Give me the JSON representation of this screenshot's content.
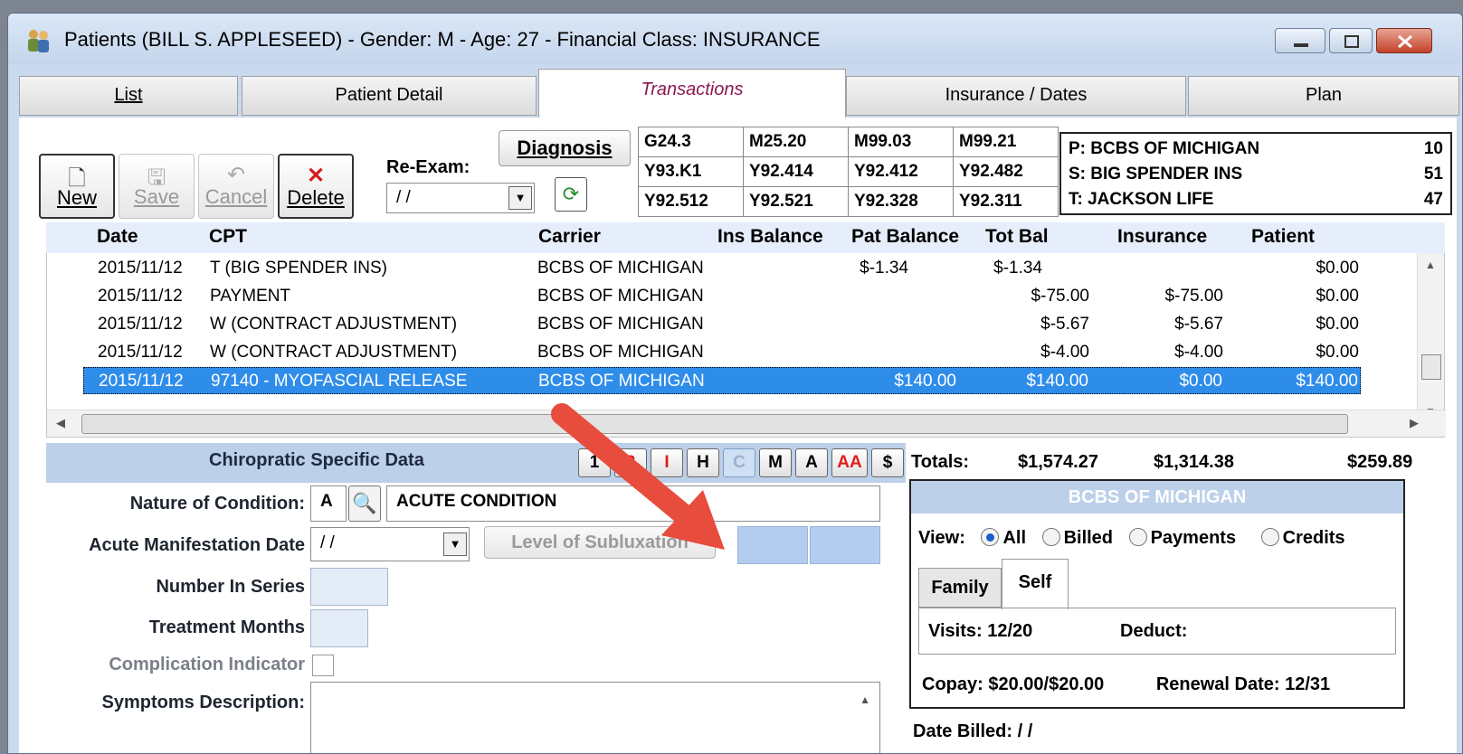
{
  "window": {
    "title": "Patients (BILL S. APPLESEED) - Gender: M - Age: 27 - Financial Class: INSURANCE"
  },
  "tabs": [
    {
      "label": "List"
    },
    {
      "label": "Patient Detail"
    },
    {
      "label": "Transactions"
    },
    {
      "label": "Insurance / Dates"
    },
    {
      "label": "Plan"
    }
  ],
  "toolbar": {
    "new_label": "New",
    "save_label": "Save",
    "cancel_label": "Cancel",
    "delete_label": "Delete",
    "reexam_label": "Re-Exam:",
    "reexam_value": "/ /",
    "diagnosis_label": "Diagnosis"
  },
  "diagnosis_codes": [
    [
      "G24.3",
      "M25.20",
      "M99.03",
      "M99.21"
    ],
    [
      "Y93.K1",
      "Y92.414",
      "Y92.412",
      "Y92.482"
    ],
    [
      "Y92.512",
      "Y92.521",
      "Y92.328",
      "Y92.311"
    ]
  ],
  "insurance_summary": [
    {
      "label": "P: BCBS OF MICHIGAN",
      "value": "10"
    },
    {
      "label": "S: BIG SPENDER INS",
      "value": "51"
    },
    {
      "label": "T: JACKSON LIFE",
      "value": "47"
    }
  ],
  "grid": {
    "headers": {
      "date": "Date",
      "cpt": "CPT",
      "carrier": "Carrier",
      "ins_balance": "Ins Balance",
      "pat_balance": "Pat Balance",
      "tot_bal": "Tot Bal",
      "insurance": "Insurance",
      "patient": "Patient"
    },
    "rows": [
      {
        "date": "2015/11/12",
        "cpt": "T (BIG SPENDER INS)",
        "carrier": "BCBS OF MICHIGAN",
        "ins_balance": "",
        "pat_balance": "",
        "tot_bal": "$-1.34",
        "insurance": "$-1.34",
        "patient": "$0.00"
      },
      {
        "date": "2015/11/12",
        "cpt": "PAYMENT",
        "carrier": "BCBS OF MICHIGAN",
        "ins_balance": "",
        "pat_balance": "",
        "tot_bal": "$-75.00",
        "insurance": "$-75.00",
        "patient": "$0.00"
      },
      {
        "date": "2015/11/12",
        "cpt": "W (CONTRACT ADJUSTMENT)",
        "carrier": "BCBS OF MICHIGAN",
        "ins_balance": "",
        "pat_balance": "",
        "tot_bal": "$-5.67",
        "insurance": "$-5.67",
        "patient": "$0.00"
      },
      {
        "date": "2015/11/12",
        "cpt": "W (CONTRACT ADJUSTMENT)",
        "carrier": "BCBS OF MICHIGAN",
        "ins_balance": "",
        "pat_balance": "",
        "tot_bal": "$-4.00",
        "insurance": "$-4.00",
        "patient": "$0.00"
      },
      {
        "date": "2015/11/12",
        "cpt": "97140 - MYOFASCIAL RELEASE",
        "carrier": "BCBS OF MICHIGAN",
        "ins_balance": "",
        "pat_balance": "$140.00",
        "tot_bal": "$140.00",
        "insurance": "$0.00",
        "patient": "$140.00"
      }
    ]
  },
  "chiro": {
    "title": "Chiropratic Specific Data",
    "buttons": [
      "1",
      "2",
      "I",
      "H",
      "C",
      "M",
      "A",
      "AA",
      "$"
    ],
    "nature_label": "Nature of Condition:",
    "nature_code": "A",
    "nature_desc": "ACUTE CONDITION",
    "acute_label": "Acute Manifestation Date",
    "acute_value": "/ /",
    "level_label": "Level of Subluxation",
    "series_label": "Number In Series",
    "months_label": "Treatment Months",
    "complication_label": "Complication Indicator",
    "symptoms_label": "Symptoms Description:"
  },
  "totals": {
    "label": "Totals:",
    "total": "$1,574.27",
    "insurance": "$1,314.38",
    "patient": "$259.89"
  },
  "carrier_panel": {
    "title": "BCBS OF MICHIGAN",
    "view_label": "View:",
    "view_options": [
      "All",
      "Billed",
      "Payments",
      "Credits"
    ],
    "view_selected": "All",
    "tab_family": "Family",
    "tab_self": "Self",
    "visits": "Visits: 12/20",
    "deduct": "Deduct:",
    "copay": "Copay: $20.00/$20.00",
    "renewal": "Renewal Date: 12/31"
  },
  "date_billed": "Date Billed:  / /",
  "colors": {
    "selection": "#2f8dea",
    "accent_red": "#e74c3c",
    "panel_blue": "#bcd0ea"
  }
}
